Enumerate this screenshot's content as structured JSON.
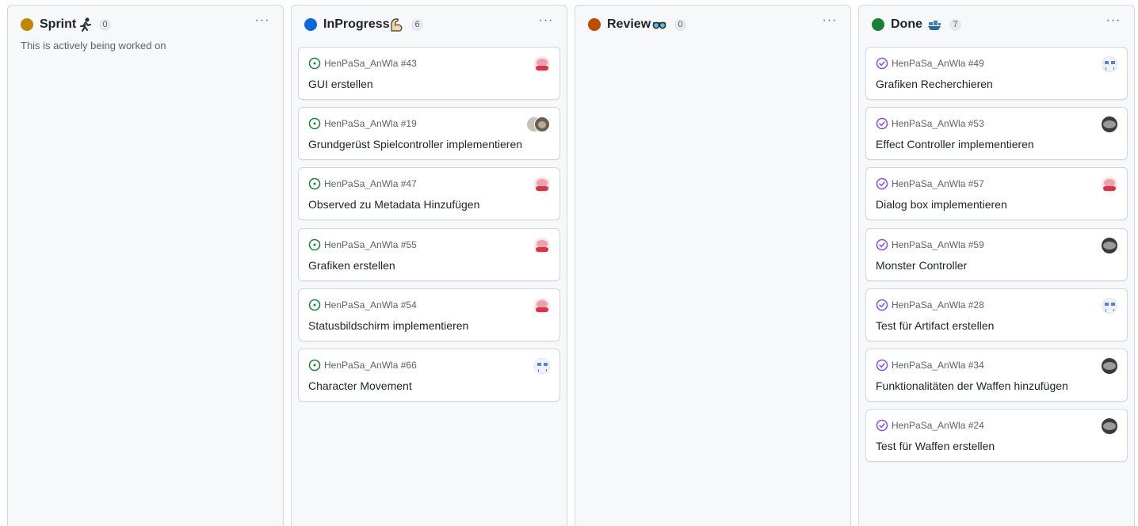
{
  "columns": [
    {
      "title": "Sprint",
      "emoji": "runner-icon",
      "color": "#bf8700",
      "count": "0",
      "description": "This is actively being worked on",
      "cards": []
    },
    {
      "title": "InProgress",
      "emoji": "flexed-arm-icon",
      "color": "#0969da",
      "count": "6",
      "description": "",
      "cards": [
        {
          "ref": "HenPaSa_AnWla #43",
          "title": "GUI erstellen",
          "state": "open",
          "avatar": "pink-avatar"
        },
        {
          "ref": "HenPaSa_AnWla #19",
          "title": "Grundgerüst Spielcontroller implementieren",
          "state": "open",
          "avatar": "stacked-avatars"
        },
        {
          "ref": "HenPaSa_AnWla #47",
          "title": "Observed zu Metadata Hinzufügen",
          "state": "open",
          "avatar": "pink-avatar"
        },
        {
          "ref": "HenPaSa_AnWla #55",
          "title": "Grafiken erstellen",
          "state": "open",
          "avatar": "pink-avatar"
        },
        {
          "ref": "HenPaSa_AnWla #54",
          "title": "Statusbildschirm implementieren",
          "state": "open",
          "avatar": "pink-avatar"
        },
        {
          "ref": "HenPaSa_AnWla #66",
          "title": "Character Movement",
          "state": "open",
          "avatar": "blue-avatar"
        }
      ]
    },
    {
      "title": "Review",
      "emoji": "goggles-icon",
      "color": "#bc4c00",
      "count": "0",
      "description": "",
      "cards": []
    },
    {
      "title": "Done",
      "emoji": "ship-icon",
      "color": "#1a7f37",
      "count": "7",
      "description": "",
      "cards": [
        {
          "ref": "HenPaSa_AnWla #49",
          "title": "Grafiken Recherchieren",
          "state": "done",
          "avatar": "blue-avatar"
        },
        {
          "ref": "HenPaSa_AnWla #53",
          "title": "Effect Controller implementieren",
          "state": "done",
          "avatar": "dark-avatar"
        },
        {
          "ref": "HenPaSa_AnWla #57",
          "title": "Dialog box implementieren",
          "state": "done",
          "avatar": "pink-avatar"
        },
        {
          "ref": "HenPaSa_AnWla #59",
          "title": "Monster Controller",
          "state": "done",
          "avatar": "dark-avatar"
        },
        {
          "ref": "HenPaSa_AnWla #28",
          "title": "Test für Artifact erstellen",
          "state": "done",
          "avatar": "blue-avatar"
        },
        {
          "ref": "HenPaSa_AnWla #34",
          "title": "Funktionalitäten der Waffen hinzufügen",
          "state": "done",
          "avatar": "dark-avatar"
        },
        {
          "ref": "HenPaSa_AnWla #24",
          "title": "Test für Waffen erstellen",
          "state": "done",
          "avatar": "dark-avatar"
        }
      ]
    }
  ],
  "colors": {
    "open_issue": "#1a7f37",
    "done_issue": "#8250df"
  }
}
